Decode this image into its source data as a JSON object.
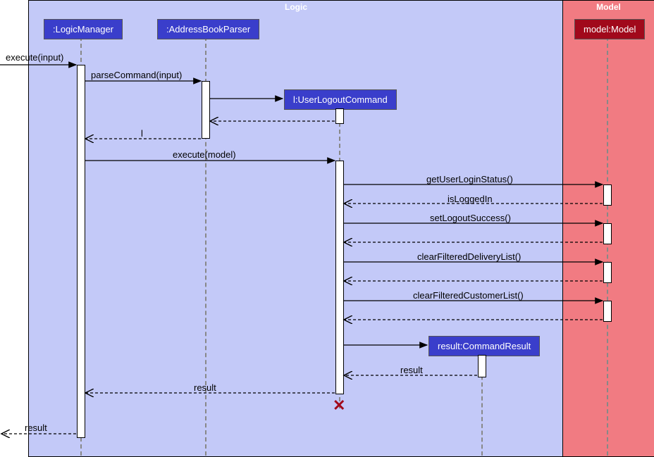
{
  "frames": {
    "logic": "Logic",
    "model": "Model"
  },
  "participants": {
    "logicManager": ":LogicManager",
    "parser": ":AddressBookParser",
    "logoutCmd": "l:UserLogoutCommand",
    "cmdResult": "result:CommandResult",
    "model": "model:Model"
  },
  "messages": {
    "m1": "execute(input)",
    "m2": "parseCommand(input)",
    "m3": "l",
    "m4": "execute(model)",
    "m5": "getUserLoginStatus()",
    "m6": "isLoggedIn",
    "m7": "setLogoutSuccess()",
    "m8": "clearFilteredDeliveryList()",
    "m9": "clearFilteredCustomerList()",
    "m10": "result",
    "m11": "result",
    "m12": "result"
  },
  "chart_data": {
    "type": "sequence-diagram",
    "frames": [
      {
        "name": "Logic",
        "participants": [
          "LogicManager",
          "AddressBookParser",
          "UserLogoutCommand",
          "CommandResult"
        ]
      },
      {
        "name": "Model",
        "participants": [
          "Model"
        ]
      }
    ],
    "participants": [
      {
        "id": "LogicManager",
        "label": ":LogicManager"
      },
      {
        "id": "AddressBookParser",
        "label": ":AddressBookParser"
      },
      {
        "id": "UserLogoutCommand",
        "label": "l:UserLogoutCommand",
        "created_by": "AddressBookParser"
      },
      {
        "id": "CommandResult",
        "label": "result:CommandResult",
        "created_by": "UserLogoutCommand"
      },
      {
        "id": "Model",
        "label": "model:Model"
      }
    ],
    "messages": [
      {
        "from": "external",
        "to": "LogicManager",
        "label": "execute(input)",
        "kind": "sync"
      },
      {
        "from": "LogicManager",
        "to": "AddressBookParser",
        "label": "parseCommand(input)",
        "kind": "sync"
      },
      {
        "from": "AddressBookParser",
        "to": "UserLogoutCommand",
        "label": "",
        "kind": "create"
      },
      {
        "from": "UserLogoutCommand",
        "to": "AddressBookParser",
        "label": "",
        "kind": "return"
      },
      {
        "from": "AddressBookParser",
        "to": "LogicManager",
        "label": "l",
        "kind": "return"
      },
      {
        "from": "LogicManager",
        "to": "UserLogoutCommand",
        "label": "execute(model)",
        "kind": "sync"
      },
      {
        "from": "UserLogoutCommand",
        "to": "Model",
        "label": "getUserLoginStatus()",
        "kind": "sync"
      },
      {
        "from": "Model",
        "to": "UserLogoutCommand",
        "label": "isLoggedIn",
        "kind": "return"
      },
      {
        "from": "UserLogoutCommand",
        "to": "Model",
        "label": "setLogoutSuccess()",
        "kind": "sync"
      },
      {
        "from": "Model",
        "to": "UserLogoutCommand",
        "label": "",
        "kind": "return"
      },
      {
        "from": "UserLogoutCommand",
        "to": "Model",
        "label": "clearFilteredDeliveryList()",
        "kind": "sync"
      },
      {
        "from": "Model",
        "to": "UserLogoutCommand",
        "label": "",
        "kind": "return"
      },
      {
        "from": "UserLogoutCommand",
        "to": "Model",
        "label": "clearFilteredCustomerList()",
        "kind": "sync"
      },
      {
        "from": "Model",
        "to": "UserLogoutCommand",
        "label": "",
        "kind": "return"
      },
      {
        "from": "UserLogoutCommand",
        "to": "CommandResult",
        "label": "",
        "kind": "create"
      },
      {
        "from": "CommandResult",
        "to": "UserLogoutCommand",
        "label": "result",
        "kind": "return"
      },
      {
        "from": "UserLogoutCommand",
        "to": "LogicManager",
        "label": "result",
        "kind": "return"
      },
      {
        "from": "UserLogoutCommand",
        "to": null,
        "label": "",
        "kind": "destroy"
      },
      {
        "from": "LogicManager",
        "to": "external",
        "label": "result",
        "kind": "return"
      }
    ]
  }
}
